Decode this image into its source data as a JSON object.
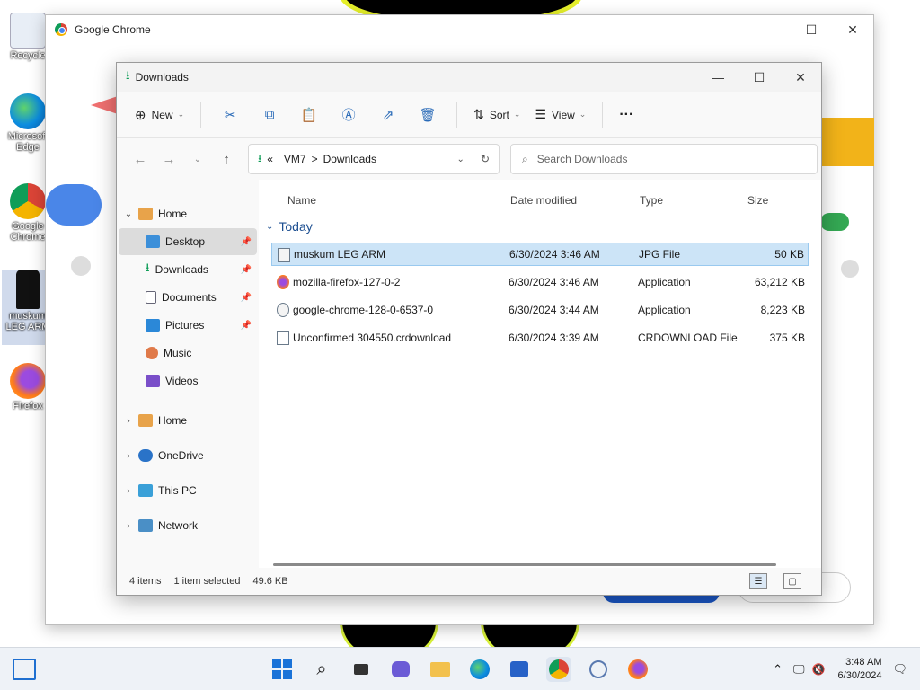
{
  "desktop": {
    "icons": [
      {
        "label": "Recycle",
        "icon": "recycle-bin-icon"
      },
      {
        "label": "Microsoft Edge",
        "icon": "edge-icon"
      },
      {
        "label": "Google Chrome",
        "icon": "chrome-icon"
      },
      {
        "label": "muskum LEG ARM",
        "icon": "image-icon"
      },
      {
        "label": "Firefox",
        "icon": "firefox-icon"
      }
    ]
  },
  "chrome": {
    "title": "Google Chrome",
    "minimize": "—",
    "maximize": "☐",
    "close": "✕"
  },
  "explorer": {
    "title": "Downloads",
    "toolbar": {
      "new_label": "New",
      "sort_label": "Sort",
      "view_label": "View",
      "more_label": "···"
    },
    "address": {
      "root": "«",
      "segments": [
        "VM7",
        "Downloads"
      ],
      "separator": ">"
    },
    "search_placeholder": "Search Downloads",
    "nav": {
      "quick": [
        {
          "label": "Home"
        },
        {
          "label": "Desktop",
          "pinned": true
        },
        {
          "label": "Downloads",
          "pinned": true
        },
        {
          "label": "Documents",
          "pinned": true
        },
        {
          "label": "Pictures",
          "pinned": true
        },
        {
          "label": "Music"
        },
        {
          "label": "Videos"
        }
      ],
      "tree": [
        {
          "label": "Home"
        },
        {
          "label": "OneDrive"
        },
        {
          "label": "This PC"
        },
        {
          "label": "Network"
        }
      ]
    },
    "columns": {
      "name": "Name",
      "date": "Date modified",
      "type": "Type",
      "size": "Size"
    },
    "group": "Today",
    "files": [
      {
        "name": "muskum LEG ARM",
        "date": "6/30/2024 3:46 AM",
        "type": "JPG File",
        "size": "50 KB",
        "selected": true
      },
      {
        "name": "mozilla-firefox-127-0-2",
        "date": "6/30/2024 3:46 AM",
        "type": "Application",
        "size": "63,212 KB"
      },
      {
        "name": "google-chrome-128-0-6537-0",
        "date": "6/30/2024 3:44 AM",
        "type": "Application",
        "size": "8,223 KB"
      },
      {
        "name": "Unconfirmed 304550.crdownload",
        "date": "6/30/2024 3:39 AM",
        "type": "CRDOWNLOAD File",
        "size": "375 KB"
      }
    ],
    "status": {
      "count": "4 items",
      "selection": "1 item selected",
      "size": "49.6 KB"
    }
  },
  "taskbar": {
    "time": "3:48 AM",
    "date": "6/30/2024"
  },
  "colors": {
    "accent": "#0067c0",
    "selection": "#cce4f7",
    "group_header": "#1d4f91"
  }
}
